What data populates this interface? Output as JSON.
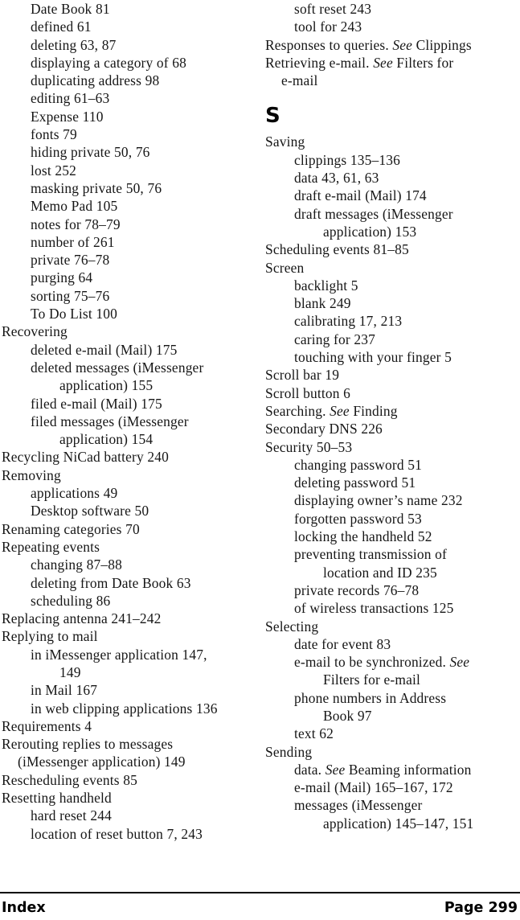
{
  "document": {
    "kind": "book-index-page",
    "footer": {
      "left_label": "Index",
      "right_label": "Page 299"
    },
    "text_color": "#161616",
    "background_color": "#ffffff"
  },
  "left_column": [
    {
      "level": 1,
      "text": "Date Book 81"
    },
    {
      "level": 1,
      "text": "defined 61"
    },
    {
      "level": 1,
      "text": "deleting 63, 87"
    },
    {
      "level": 1,
      "text": "displaying a category of 68"
    },
    {
      "level": 1,
      "text": "duplicating address 98"
    },
    {
      "level": 1,
      "text": "editing 61–63"
    },
    {
      "level": 1,
      "text": "Expense 110"
    },
    {
      "level": 1,
      "text": "fonts 79"
    },
    {
      "level": 1,
      "text": "hiding private 50, 76"
    },
    {
      "level": 1,
      "text": "lost 252"
    },
    {
      "level": 1,
      "text": "masking private 50, 76"
    },
    {
      "level": 1,
      "text": "Memo Pad 105"
    },
    {
      "level": 1,
      "text": "notes for 78–79"
    },
    {
      "level": 1,
      "text": "number of 261"
    },
    {
      "level": 1,
      "text": "private 76–78"
    },
    {
      "level": 1,
      "text": "purging 64"
    },
    {
      "level": 1,
      "text": "sorting 75–76"
    },
    {
      "level": 1,
      "text": "To Do List 100"
    },
    {
      "level": 0,
      "text": "Recovering"
    },
    {
      "level": 1,
      "text": "deleted e-mail (Mail) 175"
    },
    {
      "level": 1,
      "text": "deleted messages (iMessenger"
    },
    {
      "level": 2,
      "text": "application) 155"
    },
    {
      "level": 1,
      "text": "filed e-mail (Mail) 175"
    },
    {
      "level": 1,
      "text": "filed messages (iMessenger"
    },
    {
      "level": 2,
      "text": "application) 154"
    },
    {
      "level": 0,
      "text": "Recycling NiCad battery 240"
    },
    {
      "level": 0,
      "text": "Removing"
    },
    {
      "level": 1,
      "text": "applications 49"
    },
    {
      "level": 1,
      "text": "Desktop software 50"
    },
    {
      "level": 0,
      "text": "Renaming categories 70"
    },
    {
      "level": 0,
      "text": "Repeating events"
    },
    {
      "level": 1,
      "text": "changing 87–88"
    },
    {
      "level": 1,
      "text": "deleting from Date Book 63"
    },
    {
      "level": 1,
      "text": "scheduling 86"
    },
    {
      "level": 0,
      "text": "Replacing antenna 241–242"
    },
    {
      "level": 0,
      "text": "Replying to mail"
    },
    {
      "level": 1,
      "text": "in iMessenger application 147,"
    },
    {
      "level": 2,
      "text": "149"
    },
    {
      "level": 1,
      "text": "in Mail 167"
    },
    {
      "level": 1,
      "text": "in web clipping applications 136"
    },
    {
      "level": 0,
      "text": "Requirements 4"
    },
    {
      "level": 0,
      "text": "Rerouting replies to messages"
    },
    {
      "level": 3,
      "text": "(iMessenger application) 149"
    },
    {
      "level": 0,
      "text": "Rescheduling events 85"
    },
    {
      "level": 0,
      "text": "Resetting handheld"
    },
    {
      "level": 1,
      "text": "hard reset 244"
    },
    {
      "level": 1,
      "text": "location of reset button 7, 243"
    }
  ],
  "right_column": [
    {
      "level": 1,
      "text": "soft reset 243"
    },
    {
      "level": 1,
      "text": "tool for 243"
    },
    {
      "level": 0,
      "parts": [
        {
          "style": "roman",
          "text": "Responses to queries. "
        },
        {
          "style": "italic",
          "text": "See"
        },
        {
          "style": "roman",
          "text": " Clippings"
        }
      ]
    },
    {
      "level": 0,
      "parts": [
        {
          "style": "roman",
          "text": "Retrieving e-mail. "
        },
        {
          "style": "italic",
          "text": "See"
        },
        {
          "style": "roman",
          "text": " Filters for"
        }
      ]
    },
    {
      "level": 3,
      "text": "e-mail"
    },
    {
      "level": "letter",
      "text": "S"
    },
    {
      "level": 0,
      "text": "Saving"
    },
    {
      "level": 1,
      "text": "clippings 135–136"
    },
    {
      "level": 1,
      "text": "data 43, 61, 63"
    },
    {
      "level": 1,
      "text": "draft e-mail (Mail) 174"
    },
    {
      "level": 1,
      "text": "draft messages (iMessenger"
    },
    {
      "level": 2,
      "text": "application) 153"
    },
    {
      "level": 0,
      "text": "Scheduling events 81–85"
    },
    {
      "level": 0,
      "text": "Screen"
    },
    {
      "level": 1,
      "text": "backlight 5"
    },
    {
      "level": 1,
      "text": "blank 249"
    },
    {
      "level": 1,
      "text": "calibrating 17, 213"
    },
    {
      "level": 1,
      "text": "caring for 237"
    },
    {
      "level": 1,
      "text": "touching with your finger 5"
    },
    {
      "level": 0,
      "text": "Scroll bar 19"
    },
    {
      "level": 0,
      "text": "Scroll button 6"
    },
    {
      "level": 0,
      "parts": [
        {
          "style": "roman",
          "text": "Searching. "
        },
        {
          "style": "italic",
          "text": "See"
        },
        {
          "style": "roman",
          "text": " Finding"
        }
      ]
    },
    {
      "level": 0,
      "text": "Secondary DNS 226"
    },
    {
      "level": 0,
      "text": "Security 50–53"
    },
    {
      "level": 1,
      "text": "changing password 51"
    },
    {
      "level": 1,
      "text": "deleting password 51"
    },
    {
      "level": 1,
      "text": "displaying owner’s name 232"
    },
    {
      "level": 1,
      "text": "forgotten password 53"
    },
    {
      "level": 1,
      "text": "locking the handheld 52"
    },
    {
      "level": 1,
      "text": "preventing transmission of"
    },
    {
      "level": 2,
      "text": "location and ID 235"
    },
    {
      "level": 1,
      "text": "private records 76–78"
    },
    {
      "level": 1,
      "text": "of wireless transactions 125"
    },
    {
      "level": 0,
      "text": "Selecting"
    },
    {
      "level": 1,
      "text": "date for event 83"
    },
    {
      "level": 1,
      "parts": [
        {
          "style": "roman",
          "text": "e-mail to be synchronized. "
        },
        {
          "style": "italic",
          "text": "See"
        }
      ]
    },
    {
      "level": 2,
      "text": "Filters for e-mail"
    },
    {
      "level": 1,
      "text": "phone numbers in Address"
    },
    {
      "level": 2,
      "text": "Book 97"
    },
    {
      "level": 1,
      "text": "text 62"
    },
    {
      "level": 0,
      "text": "Sending"
    },
    {
      "level": 1,
      "parts": [
        {
          "style": "roman",
          "text": "data. "
        },
        {
          "style": "italic",
          "text": "See"
        },
        {
          "style": "roman",
          "text": " Beaming information"
        }
      ]
    },
    {
      "level": 1,
      "text": "e-mail (Mail) 165–167, 172"
    },
    {
      "level": 1,
      "text": "messages (iMessenger"
    },
    {
      "level": 2,
      "text": "application) 145–147, 151"
    }
  ]
}
